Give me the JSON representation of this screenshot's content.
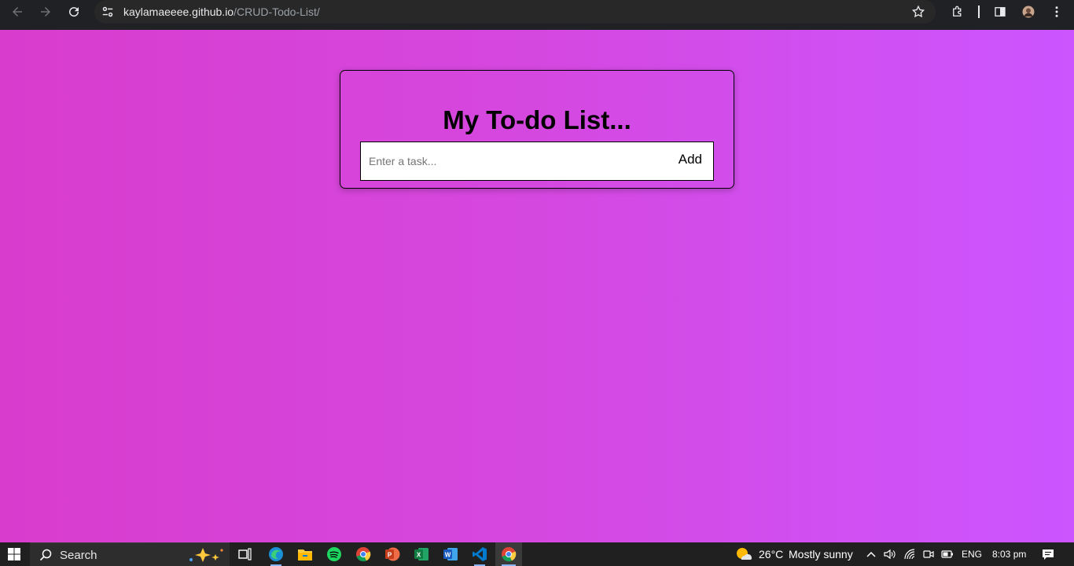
{
  "browser": {
    "url_host": "kaylamaeeee.github.io",
    "url_path": "/CRUD-Todo-List/"
  },
  "page": {
    "title": "My To-do List...",
    "input_placeholder": "Enter a task...",
    "add_label": "Add",
    "colors": {
      "gradient_start": "#d83ccd",
      "gradient_end": "#cc55ff"
    }
  },
  "taskbar": {
    "search_label": "Search",
    "temperature": "26°C",
    "weather": "Mostly sunny",
    "language": "ENG",
    "time": "8:03 pm",
    "apps": [
      "edge-icon",
      "file-explorer-icon",
      "spotify-icon",
      "chrome-icon",
      "powerpoint-icon",
      "excel-icon",
      "word-icon",
      "vscode-icon",
      "chrome-active-icon"
    ]
  }
}
